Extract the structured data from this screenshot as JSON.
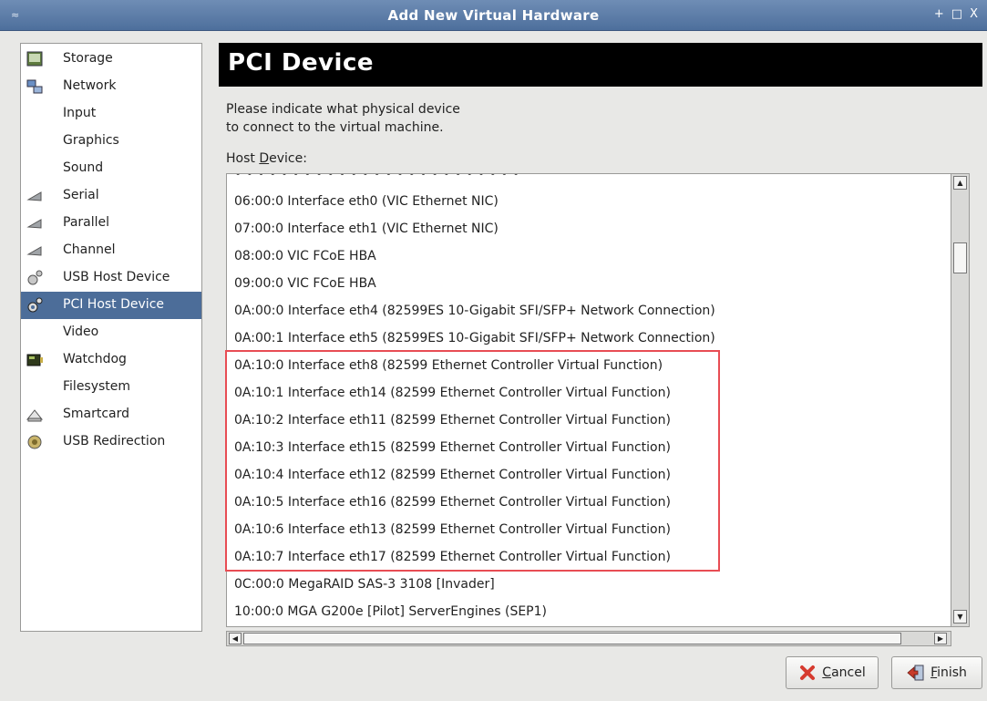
{
  "window": {
    "title": "Add New Virtual Hardware",
    "controls": [
      "+",
      "□",
      "X"
    ]
  },
  "sidebar": {
    "items": [
      {
        "label": "Storage",
        "icon": "storage-icon"
      },
      {
        "label": "Network",
        "icon": "network-icon"
      },
      {
        "label": "Input",
        "icon": ""
      },
      {
        "label": "Graphics",
        "icon": ""
      },
      {
        "label": "Sound",
        "icon": ""
      },
      {
        "label": "Serial",
        "icon": "serial-port-icon"
      },
      {
        "label": "Parallel",
        "icon": "parallel-port-icon"
      },
      {
        "label": "Channel",
        "icon": "channel-icon"
      },
      {
        "label": "USB Host Device",
        "icon": "usb-device-icon"
      },
      {
        "label": "PCI Host Device",
        "icon": "pci-device-icon",
        "selected": true
      },
      {
        "label": "Video",
        "icon": ""
      },
      {
        "label": "Watchdog",
        "icon": "watchdog-icon"
      },
      {
        "label": "Filesystem",
        "icon": ""
      },
      {
        "label": "Smartcard",
        "icon": "smartcard-icon"
      },
      {
        "label": "USB Redirection",
        "icon": "usb-redirection-icon"
      }
    ]
  },
  "main": {
    "title": "PCI Device",
    "description_line1": "Please indicate what physical device",
    "description_line2": "to connect to the virtual machine.",
    "host_device_label_prefix": "Host ",
    "host_device_label_mnemonic": "D",
    "host_device_label_suffix": "evice:",
    "devices": [
      "06:00:0 Interface eth0 (VIC Ethernet NIC)",
      "07:00:0 Interface eth1 (VIC Ethernet NIC)",
      "08:00:0 VIC FCoE HBA",
      "09:00:0 VIC FCoE HBA",
      "0A:00:0 Interface eth4 (82599ES 10-Gigabit SFI/SFP+ Network Connection)",
      "0A:00:1 Interface eth5 (82599ES 10-Gigabit SFI/SFP+ Network Connection)",
      "0A:10:0 Interface eth8 (82599 Ethernet Controller Virtual Function)",
      "0A:10:1 Interface eth14 (82599 Ethernet Controller Virtual Function)",
      "0A:10:2 Interface eth11 (82599 Ethernet Controller Virtual Function)",
      "0A:10:3 Interface eth15 (82599 Ethernet Controller Virtual Function)",
      "0A:10:4 Interface eth12 (82599 Ethernet Controller Virtual Function)",
      "0A:10:5 Interface eth16 (82599 Ethernet Controller Virtual Function)",
      "0A:10:6 Interface eth13 (82599 Ethernet Controller Virtual Function)",
      "0A:10:7 Interface eth17 (82599 Ethernet Controller Virtual Function)",
      "0C:00:0 MegaRAID SAS-3 3108 [Invader]",
      "10:00:0 MGA G200e [Pilot] ServerEngines (SEP1)"
    ]
  },
  "buttons": {
    "cancel_mnemonic": "C",
    "cancel_rest": "ancel",
    "finish_mnemonic": "F",
    "finish_rest": "inish"
  },
  "colors": {
    "titlebar": "#5a7ba8",
    "selection": "#4c6d99",
    "header_bg": "#000000",
    "highlight_border": "#e84d54"
  }
}
